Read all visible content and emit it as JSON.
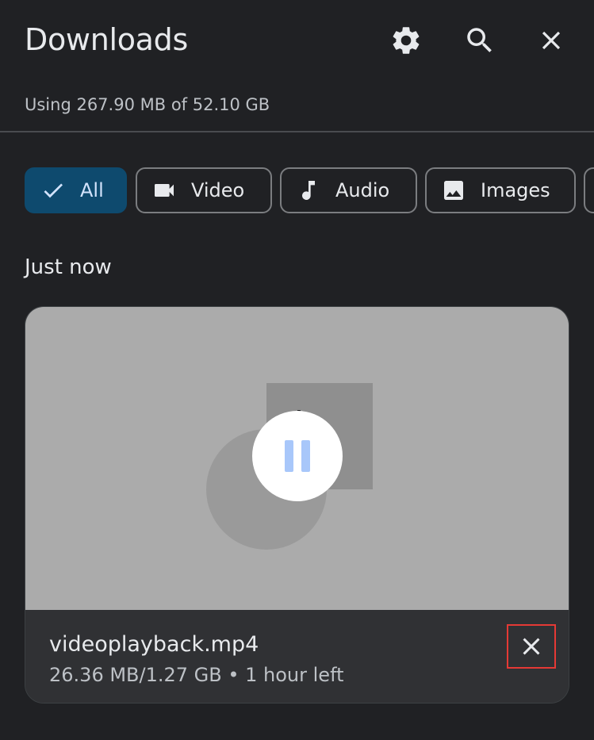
{
  "header": {
    "title": "Downloads",
    "settings_icon": "gear-icon",
    "search_icon": "search-icon",
    "close_icon": "close-icon"
  },
  "storage": {
    "text": "Using 267.90 MB of 52.10 GB"
  },
  "filters": [
    {
      "label": "All",
      "icon": "check-icon",
      "selected": true
    },
    {
      "label": "Video",
      "icon": "videocam-icon",
      "selected": false
    },
    {
      "label": "Audio",
      "icon": "music-note-icon",
      "selected": false
    },
    {
      "label": "Images",
      "icon": "image-icon",
      "selected": false
    }
  ],
  "section": {
    "title": "Just now"
  },
  "download": {
    "filename": "videoplayback.mp4",
    "progress_text": "26.36 MB/1.27 GB • 1 hour left",
    "state": "downloading",
    "action_icon": "pause-icon",
    "cancel_icon": "close-icon"
  },
  "colors": {
    "background": "#202124",
    "selected_chip": "#0e4a6e",
    "highlight_border": "#e53935",
    "pause_bars": "#a8c7fa"
  }
}
